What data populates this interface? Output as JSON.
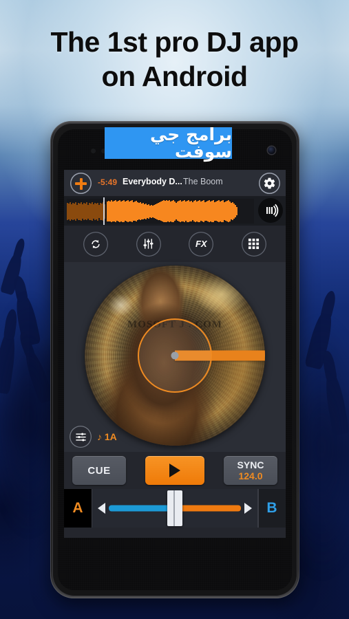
{
  "headline": {
    "line1": "The 1st pro DJ app",
    "line2": "on Android"
  },
  "watermark_banner": {
    "text": "برامج جي سوفت",
    "bg_color": "#2f96f2",
    "text_color": "#ffffff"
  },
  "app": {
    "topbar": {
      "add_icon": "plus-icon",
      "remaining_time": "-5:49",
      "track_title": "Everybody D...",
      "track_artist": "The Boom",
      "settings_icon": "gear-icon"
    },
    "waveform": {
      "vinyl_icon": "vinyl-mode-icon",
      "played_color": "#8a4a0e",
      "remaining_color": "#f7871f",
      "playhead_color": "#c9cdd6"
    },
    "function_buttons": [
      {
        "name": "loop-button",
        "icon": "loop-arrows-icon",
        "label": ""
      },
      {
        "name": "eq-button",
        "icon": "eq-sliders-icon",
        "label": ""
      },
      {
        "name": "fx-button",
        "icon": "fx-text-icon",
        "label": "FX"
      },
      {
        "name": "sampler-button",
        "icon": "grid-3x3-icon",
        "label": ""
      }
    ],
    "deck": {
      "album_watermark": "MOSOFT J . COM",
      "accent_color": "#ef8b22",
      "key_icon": "pitch-slider-icon",
      "key_label": "♪ 1A"
    },
    "transport": {
      "cue_label": "CUE",
      "play_icon": "play-triangle-icon",
      "sync_label": "SYNC",
      "sync_bpm": "124.0",
      "play_bg": "#ef7a08"
    },
    "crossfader": {
      "deck_a_label": "A",
      "deck_b_label": "B",
      "left_arrow_icon": "arrow-left-icon",
      "right_arrow_icon": "arrow-right-icon",
      "handle_icon": "crossfader-handle",
      "a_color": "#1c9ad6",
      "b_color": "#ef7a10",
      "position_percent": 50
    }
  }
}
